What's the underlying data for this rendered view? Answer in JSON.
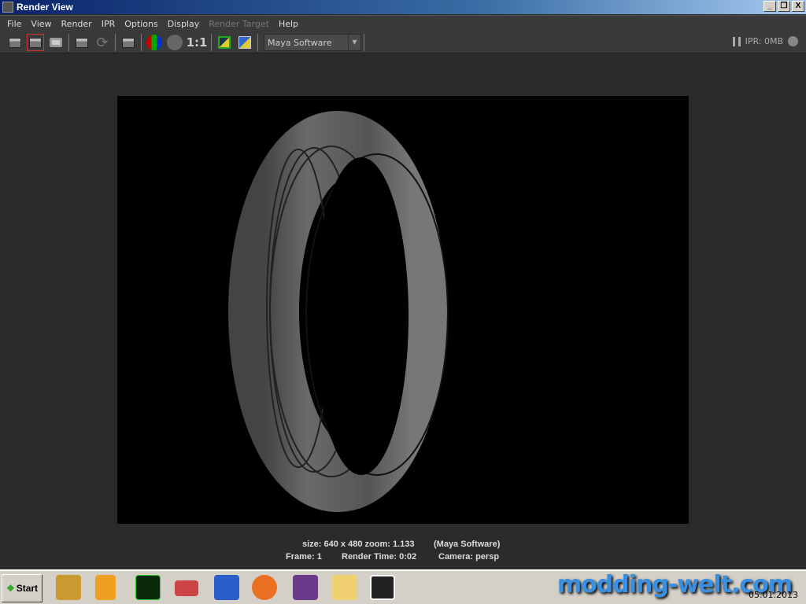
{
  "window": {
    "title": "Render View",
    "minimize": "_",
    "restore": "❐",
    "close": "X"
  },
  "menu": [
    "File",
    "View",
    "Render",
    "IPR",
    "Options",
    "Display",
    "Render Target",
    "Help"
  ],
  "toolbar": {
    "ratio": "1:1",
    "renderer": "Maya Software",
    "ipr": "IPR: 0MB"
  },
  "status": {
    "line1_size": "size: 640 x 480 zoom: 1.133",
    "line1_renderer": "(Maya Software)",
    "frame": "Frame: 1",
    "render_time": "Render Time: 0:02",
    "camera": "Camera: persp"
  },
  "taskbar": {
    "start": "Start",
    "watermark": "modding-welt.com",
    "date": "05.01.2013"
  }
}
